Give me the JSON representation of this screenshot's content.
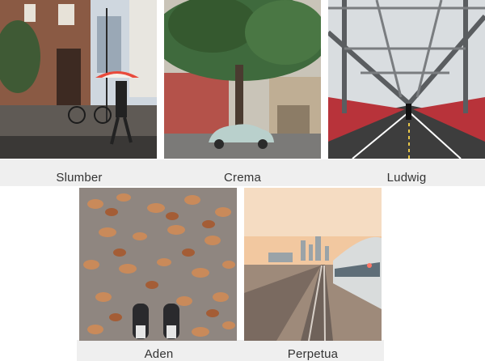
{
  "filters": [
    {
      "name": "Slumber"
    },
    {
      "name": "Crema"
    },
    {
      "name": "Ludwig"
    },
    {
      "name": "Aden"
    },
    {
      "name": "Perpetua"
    }
  ],
  "colors": {
    "background": "#ffffff",
    "caption_band": "#efefef",
    "caption_text": "#333333"
  }
}
